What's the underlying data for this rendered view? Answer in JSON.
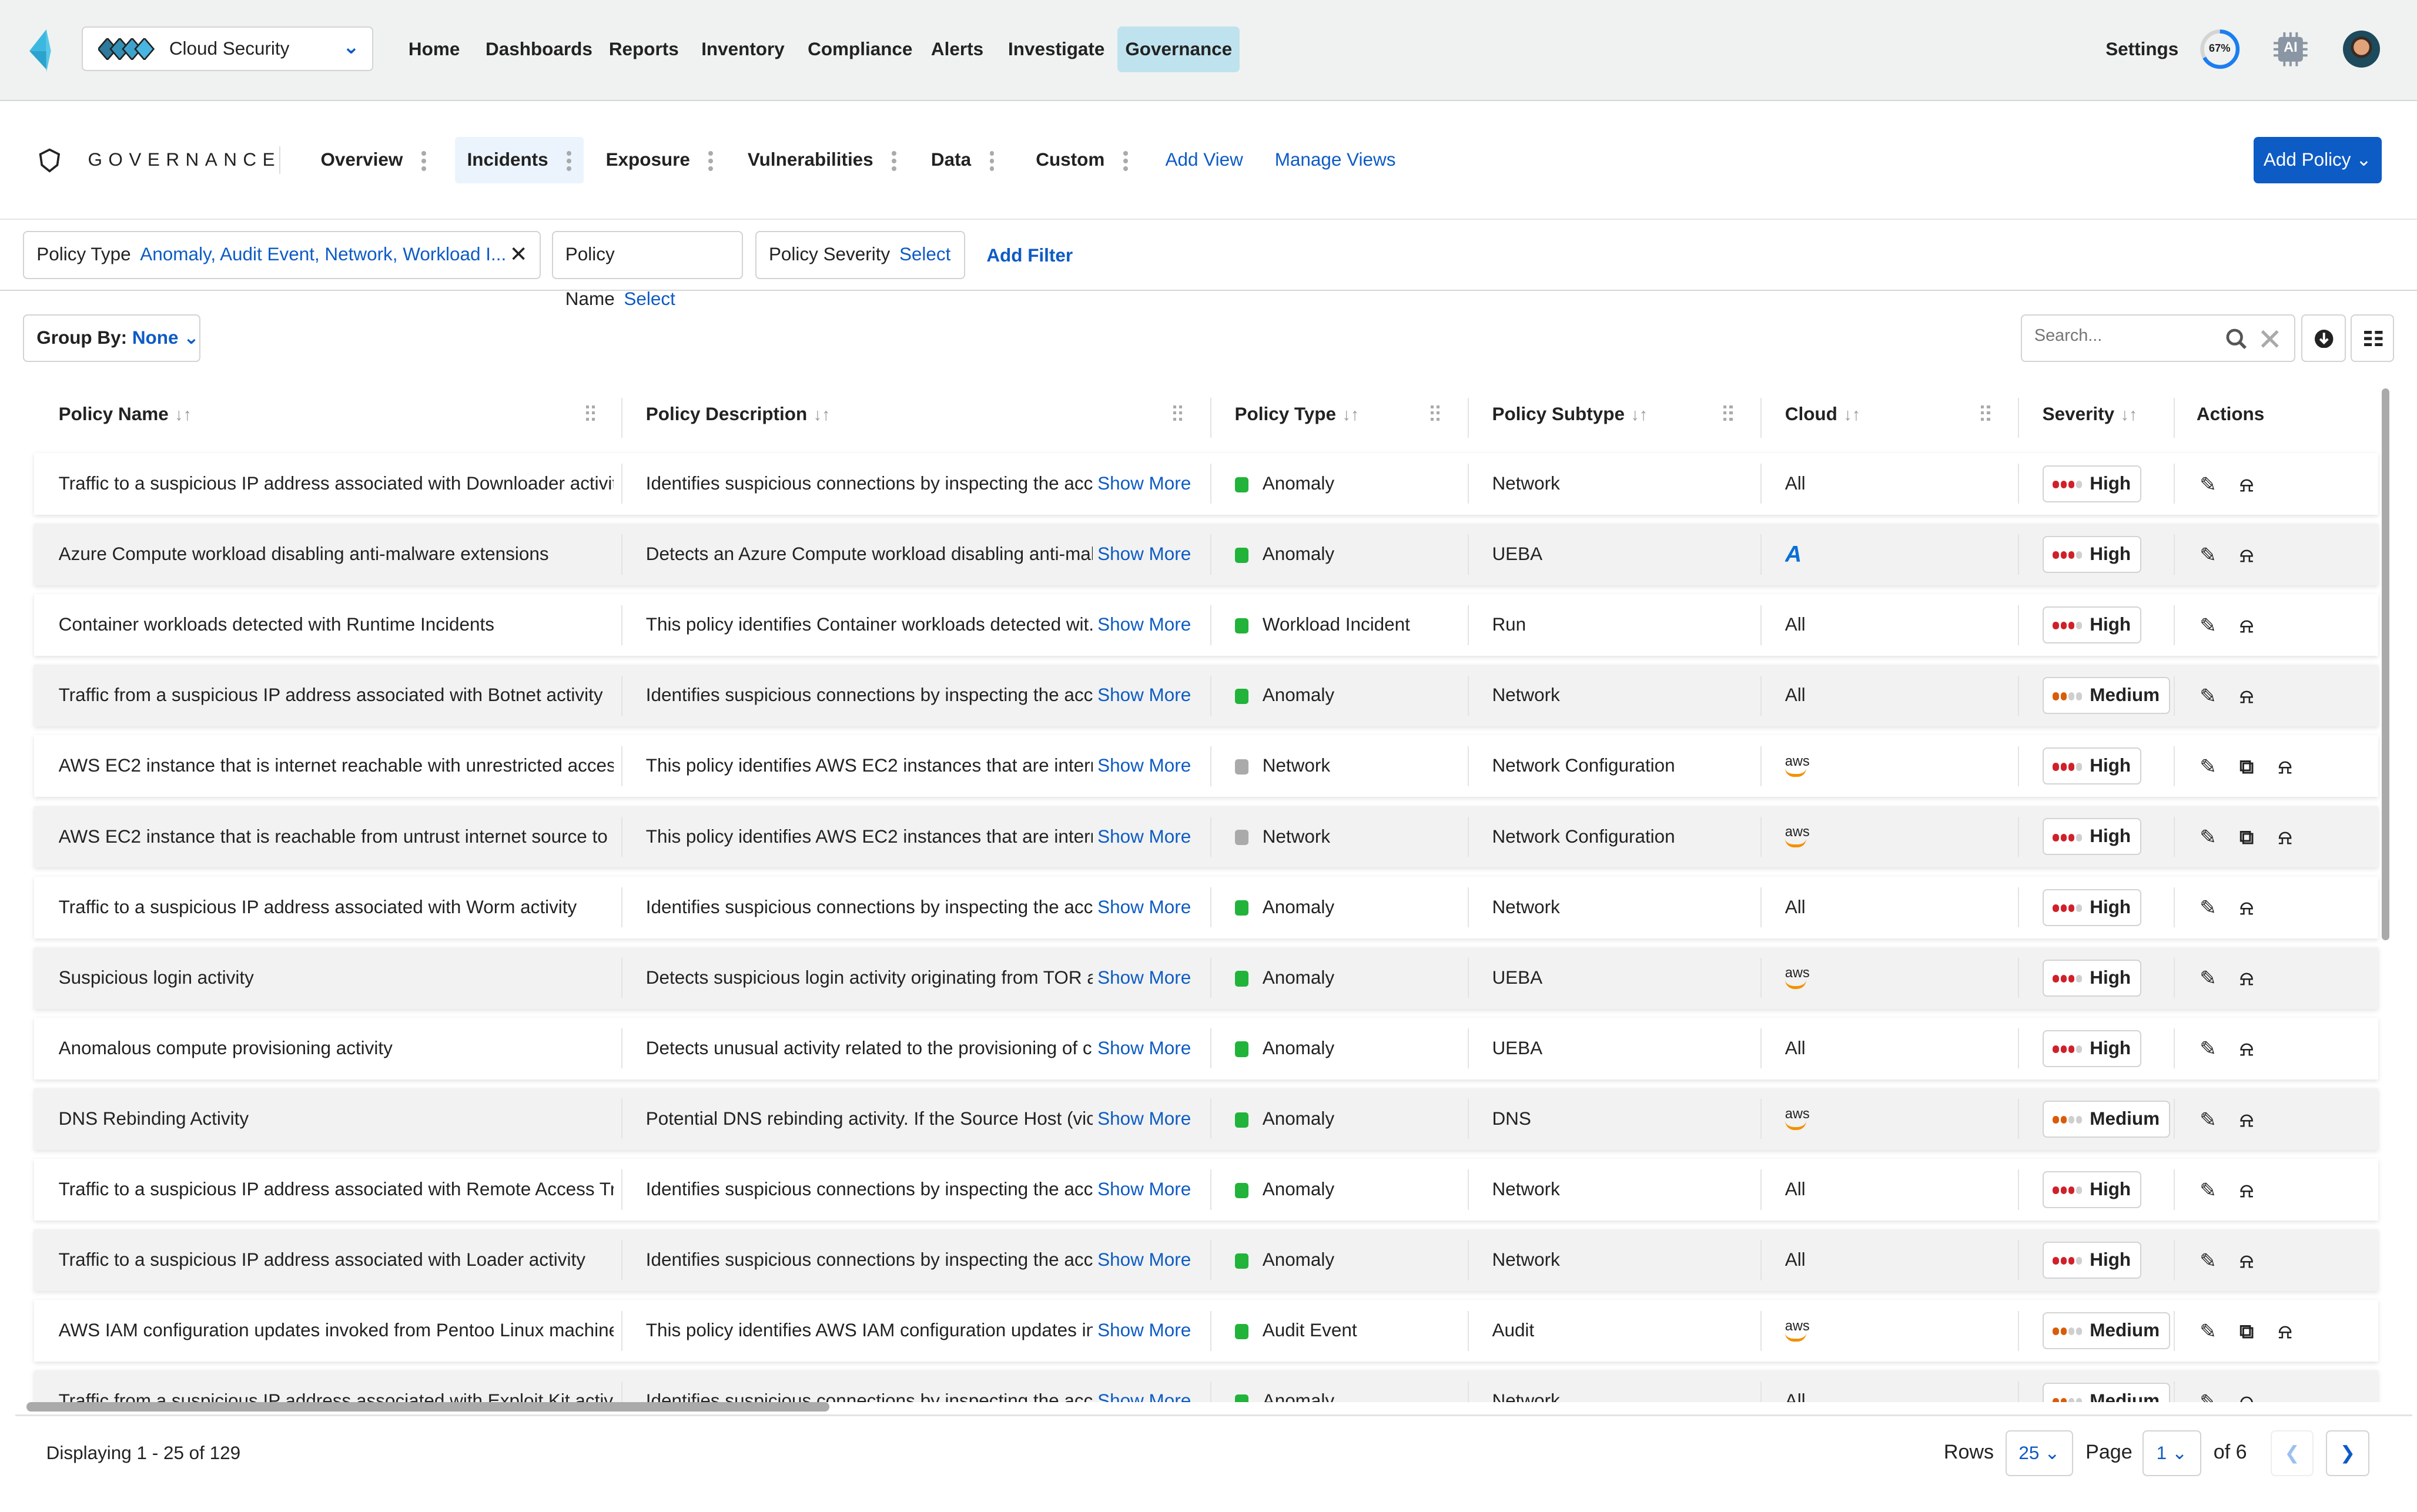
{
  "topbar": {
    "product": "Cloud Security",
    "nav": [
      "Home",
      "Dashboards",
      "Reports",
      "Inventory",
      "Compliance",
      "Alerts",
      "Investigate",
      "Governance"
    ],
    "active_nav": "Governance",
    "settings": "Settings",
    "progress": {
      "label": "67%",
      "value": 67
    },
    "ai_label": "AI",
    "colors": {
      "accent": "#0d5bc5",
      "active_nav_bg": "#bfe3ee",
      "ring": "#1b7ef0"
    }
  },
  "subheader": {
    "title": "GOVERNANCE",
    "tabs": [
      "Overview",
      "Incidents",
      "Exposure",
      "Vulnerabilities",
      "Data",
      "Custom"
    ],
    "active_tab": "Incidents",
    "add_view": "Add View",
    "manage_views": "Manage Views",
    "add_policy": "Add Policy"
  },
  "filters": {
    "policy_type_label": "Policy Type",
    "policy_type_value": "Anomaly, Audit Event, Network, Workload I...",
    "policy_name_label": "Policy Name",
    "policy_name_value": "Select",
    "policy_severity_label": "Policy Severity",
    "policy_severity_value": "Select",
    "add_filter": "Add Filter"
  },
  "toolbar": {
    "group_by_label": "Group By:",
    "group_by_value": "None",
    "search_placeholder": "Search..."
  },
  "table": {
    "columns": [
      "Policy Name",
      "Policy Description",
      "Policy Type",
      "Policy Subtype",
      "Cloud",
      "Severity",
      "Actions"
    ],
    "show_more": "Show More",
    "rows": [
      {
        "name": "Traffic to a suspicious IP address associated with Downloader activity",
        "desc": "Identifies suspicious connections by inspecting the acce...",
        "type": "Anomaly",
        "subtype": "Network",
        "cloud": "All",
        "severity": "High",
        "actions": [
          "edit",
          "alarm"
        ]
      },
      {
        "name": "Azure Compute workload disabling anti-malware extensions",
        "desc": "Detects an Azure Compute workload disabling anti-mal...",
        "type": "Anomaly",
        "subtype": "UEBA",
        "cloud": "azure",
        "severity": "High",
        "actions": [
          "edit",
          "alarm"
        ]
      },
      {
        "name": "Container workloads detected with Runtime Incidents",
        "desc": "This policy identifies Container workloads detected wit...",
        "type": "Workload Incident",
        "subtype": "Run",
        "cloud": "All",
        "severity": "High",
        "actions": [
          "edit",
          "alarm"
        ]
      },
      {
        "name": "Traffic from a suspicious IP address associated with Botnet activity",
        "desc": "Identifies suspicious connections by inspecting the acce...",
        "type": "Anomaly",
        "subtype": "Network",
        "cloud": "All",
        "severity": "Medium",
        "actions": [
          "edit",
          "alarm"
        ]
      },
      {
        "name": "AWS EC2 instance that is internet reachable with unrestricted acces...",
        "desc": "This policy identifies AWS EC2 instances that are intern...",
        "type": "Network",
        "subtype": "Network Configuration",
        "cloud": "aws",
        "severity": "High",
        "actions": [
          "edit",
          "copy",
          "alarm"
        ]
      },
      {
        "name": "AWS EC2 instance that is reachable from untrust internet source to ...",
        "desc": "This policy identifies AWS EC2 instances that are intern...",
        "type": "Network",
        "subtype": "Network Configuration",
        "cloud": "aws",
        "severity": "High",
        "actions": [
          "edit",
          "copy",
          "alarm"
        ]
      },
      {
        "name": "Traffic to a suspicious IP address associated with Worm activity",
        "desc": "Identifies suspicious connections by inspecting the acce...",
        "type": "Anomaly",
        "subtype": "Network",
        "cloud": "All",
        "severity": "High",
        "actions": [
          "edit",
          "alarm"
        ]
      },
      {
        "name": "Suspicious login activity",
        "desc": "Detects suspicious login activity originating from TOR a...",
        "type": "Anomaly",
        "subtype": "UEBA",
        "cloud": "aws",
        "severity": "High",
        "actions": [
          "edit",
          "alarm"
        ]
      },
      {
        "name": "Anomalous compute provisioning activity",
        "desc": "Detects unusual activity related to the provisioning of c...",
        "type": "Anomaly",
        "subtype": "UEBA",
        "cloud": "All",
        "severity": "High",
        "actions": [
          "edit",
          "alarm"
        ]
      },
      {
        "name": "DNS Rebinding Activity",
        "desc": "Potential DNS rebinding activity. If the Source Host (vic...",
        "type": "Anomaly",
        "subtype": "DNS",
        "cloud": "aws",
        "severity": "Medium",
        "actions": [
          "edit",
          "alarm"
        ]
      },
      {
        "name": "Traffic to a suspicious IP address associated with Remote Access Troj...",
        "desc": "Identifies suspicious connections by inspecting the acce...",
        "type": "Anomaly",
        "subtype": "Network",
        "cloud": "All",
        "severity": "High",
        "actions": [
          "edit",
          "alarm"
        ]
      },
      {
        "name": "Traffic to a suspicious IP address associated with Loader activity",
        "desc": "Identifies suspicious connections by inspecting the acce...",
        "type": "Anomaly",
        "subtype": "Network",
        "cloud": "All",
        "severity": "High",
        "actions": [
          "edit",
          "alarm"
        ]
      },
      {
        "name": "AWS IAM configuration updates invoked from Pentoo Linux machine",
        "desc": "This policy identifies AWS IAM configuration updates in...",
        "type": "Audit Event",
        "subtype": "Audit",
        "cloud": "aws",
        "severity": "Medium",
        "actions": [
          "edit",
          "copy",
          "alarm"
        ]
      },
      {
        "name": "Traffic from a suspicious IP address associated with Exploit Kit activity",
        "desc": "Identifies suspicious connections by inspecting the acce...",
        "type": "Anomaly",
        "subtype": "Network",
        "cloud": "All",
        "severity": "Medium",
        "actions": [
          "edit",
          "alarm"
        ]
      }
    ]
  },
  "footer": {
    "displaying": "Displaying 1 - 25 of 129",
    "rows_label": "Rows",
    "rows_value": "25",
    "page_label": "Page",
    "page_value": "1",
    "of_pages": "of 6"
  },
  "severity_colors": {
    "High": "#d0202a",
    "Medium": "#d95c0a",
    "empty": "#cfcfcf"
  },
  "type_icons": {
    "Anomaly": "#22b33a",
    "Workload Incident": "#22b33a",
    "Network": "#aaaaaa",
    "Audit Event": "#22b33a"
  }
}
